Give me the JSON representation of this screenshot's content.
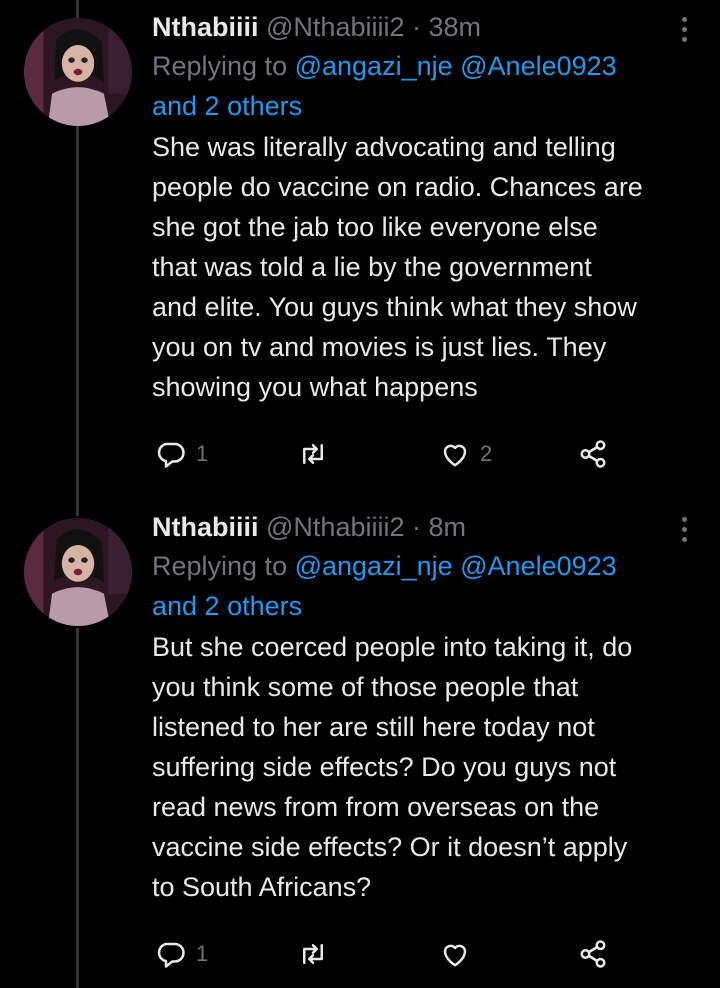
{
  "tweets": [
    {
      "name": "Nthabiiii",
      "handle": "@Nthabiiii2",
      "separator": " · ",
      "time": "38m",
      "replying_prefix": "Replying to ",
      "mention_1": "@angazi_nje",
      "mention_2": "@Anele0923",
      "others": "and 2 others",
      "text": "She was literally advocating and telling\npeople do vaccine on radio. Chances are\nshe got the jab too like everyone else\nthat was told a lie by the government\nand elite. You guys think what they show\nyou on tv and movies is just lies. They\nshowing you what happens",
      "reply_count": "1",
      "retweet_count": "",
      "like_count": "2"
    },
    {
      "name": "Nthabiiii",
      "handle": "@Nthabiiii2",
      "separator": " · ",
      "time": "8m",
      "replying_prefix": "Replying to ",
      "mention_1": "@angazi_nje",
      "mention_2": "@Anele0923",
      "others": "and 2 others",
      "text": "But she coerced people into taking it, do\nyou think some of those people that\nlistened to her are still here today not\nsuffering side effects? Do you guys not\nread news from from overseas on the\nvaccine side effects? Or it doesn’t apply\nto South Africans?",
      "reply_count": "1",
      "retweet_count": "",
      "like_count": ""
    }
  ],
  "colors": {
    "background": "#000000",
    "text": "#e7e9ea",
    "secondary": "#71767b",
    "link": "#1d9bf0",
    "thread_line": "#333639"
  },
  "icons": [
    "reply-icon",
    "retweet-icon",
    "like-icon",
    "share-icon",
    "more-icon"
  ]
}
